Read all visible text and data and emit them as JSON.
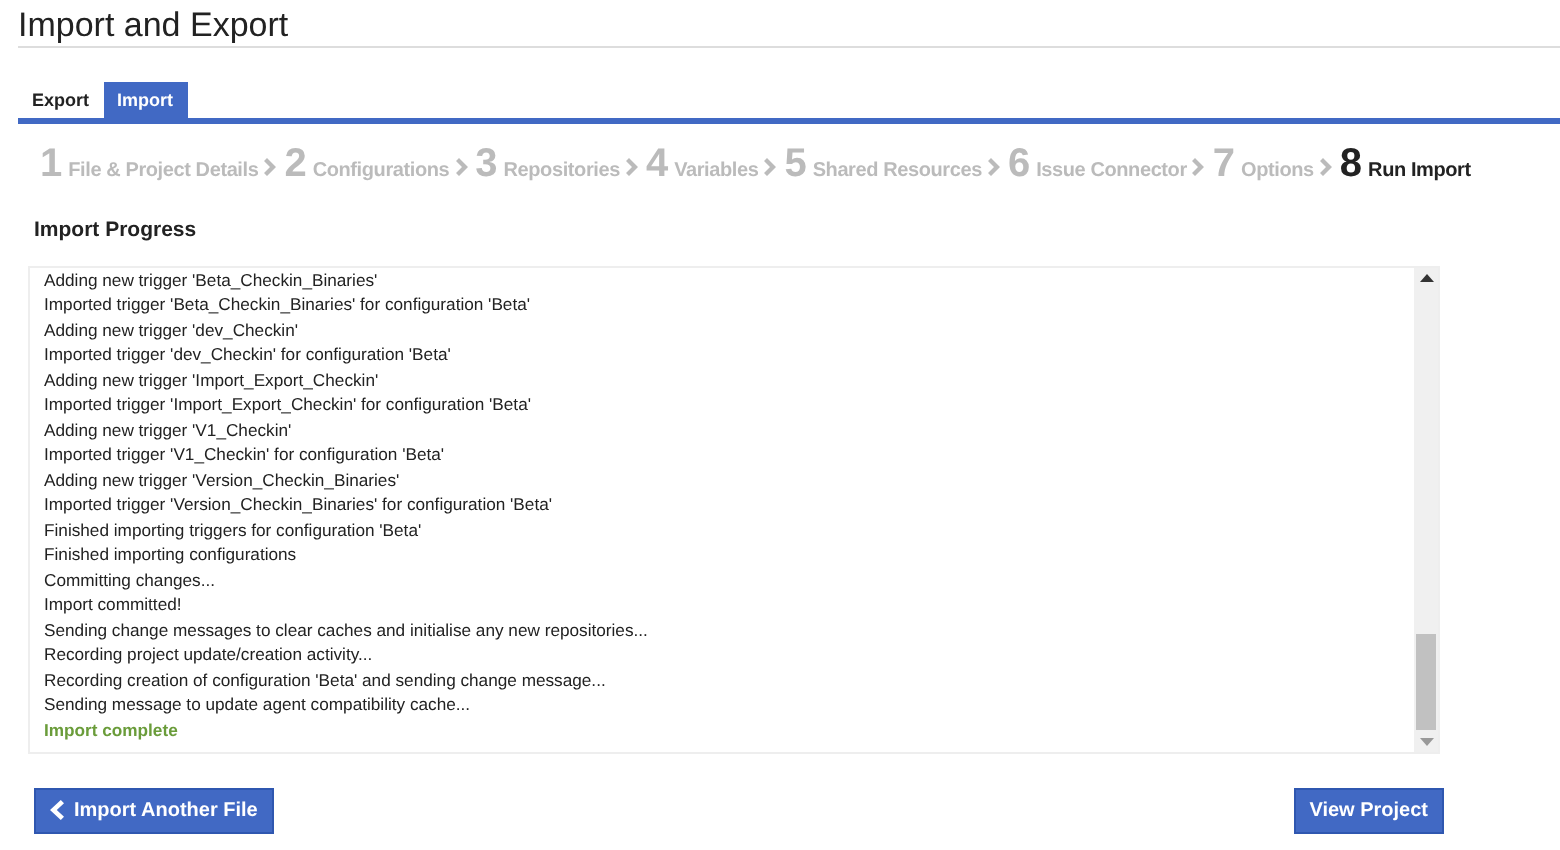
{
  "page": {
    "title": "Import and Export"
  },
  "tabs": [
    {
      "label": "Export",
      "selected": false
    },
    {
      "label": "Import",
      "selected": true
    }
  ],
  "steps": [
    {
      "number": "1",
      "label": "File & Project Details",
      "selected": false
    },
    {
      "number": "2",
      "label": "Configurations",
      "selected": false
    },
    {
      "number": "3",
      "label": "Repositories",
      "selected": false
    },
    {
      "number": "4",
      "label": "Variables",
      "selected": false
    },
    {
      "number": "5",
      "label": "Shared Resources",
      "selected": false
    },
    {
      "number": "6",
      "label": "Issue Connector",
      "selected": false
    },
    {
      "number": "7",
      "label": "Options",
      "selected": false
    },
    {
      "number": "8",
      "label": "Run Import",
      "selected": true
    }
  ],
  "progress": {
    "heading": "Import Progress",
    "log": [
      {
        "kind": "info",
        "text": "Adding new trigger 'Beta_Checkin_Binaries'"
      },
      {
        "kind": "info",
        "text": "Imported trigger 'Beta_Checkin_Binaries' for configuration 'Beta'"
      },
      {
        "kind": "info",
        "text": "Adding new trigger 'dev_Checkin'"
      },
      {
        "kind": "info",
        "text": "Imported trigger 'dev_Checkin' for configuration 'Beta'"
      },
      {
        "kind": "info",
        "text": "Adding new trigger 'Import_Export_Checkin'"
      },
      {
        "kind": "info",
        "text": "Imported trigger 'Import_Export_Checkin' for configuration 'Beta'"
      },
      {
        "kind": "info",
        "text": "Adding new trigger 'V1_Checkin'"
      },
      {
        "kind": "info",
        "text": "Imported trigger 'V1_Checkin' for configuration 'Beta'"
      },
      {
        "kind": "info",
        "text": "Adding new trigger 'Version_Checkin_Binaries'"
      },
      {
        "kind": "info",
        "text": "Imported trigger 'Version_Checkin_Binaries' for configuration 'Beta'"
      },
      {
        "kind": "info",
        "text": "Finished importing triggers for configuration 'Beta'"
      },
      {
        "kind": "info",
        "text": "Finished importing configurations"
      },
      {
        "kind": "info",
        "text": "Committing changes..."
      },
      {
        "kind": "info",
        "text": "Import committed!"
      },
      {
        "kind": "info",
        "text": "Sending change messages to clear caches and initialise any new repositories..."
      },
      {
        "kind": "info",
        "text": "Recording project update/creation activity..."
      },
      {
        "kind": "info",
        "text": "Recording creation of configuration 'Beta' and sending change message..."
      },
      {
        "kind": "info",
        "text": "Sending message to update agent compatibility cache..."
      },
      {
        "kind": "success",
        "text": "Import complete"
      }
    ]
  },
  "buttons": {
    "back": "Import Another File",
    "view": "View Project"
  }
}
